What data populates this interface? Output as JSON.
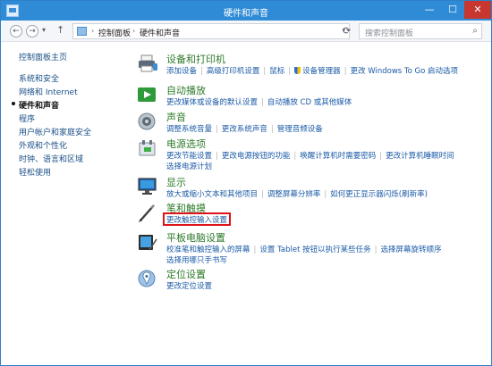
{
  "window": {
    "title": "硬件和声音",
    "min_glyph": "—",
    "max_glyph": "☐",
    "close_glyph": "✕"
  },
  "nav": {
    "back": "←",
    "forward": "→",
    "history": "▾",
    "up": "↑",
    "refresh": "⟳"
  },
  "breadcrumb": {
    "sep": "›",
    "items": [
      "控制面板",
      "硬件和声音"
    ],
    "dropdown": "▾"
  },
  "search": {
    "placeholder": "搜索控制面板",
    "icon": "⌕"
  },
  "sidebar": {
    "home": "控制面板主页",
    "items": [
      {
        "label": "系统和安全",
        "current": false
      },
      {
        "label": "网络和 Internet",
        "current": false
      },
      {
        "label": "硬件和声音",
        "current": true
      },
      {
        "label": "程序",
        "current": false
      },
      {
        "label": "用户帐户和家庭安全",
        "current": false
      },
      {
        "label": "外观和个性化",
        "current": false
      },
      {
        "label": "时钟、语言和区域",
        "current": false
      },
      {
        "label": "轻松使用",
        "current": false
      }
    ]
  },
  "categories": [
    {
      "title": "设备和打印机",
      "icon": "printer-icon",
      "links": [
        "添加设备",
        "高级打印机设置",
        "鼠标",
        "设备管理器",
        "更改 Windows To Go 启动选项"
      ],
      "link_shield": [
        false,
        false,
        false,
        true,
        false
      ]
    },
    {
      "title": "自动播放",
      "icon": "autoplay-icon",
      "links": [
        "更改媒体或设备的默认设置",
        "自动播放 CD 或其他媒体"
      ]
    },
    {
      "title": "声音",
      "icon": "speaker-icon",
      "links": [
        "调整系统音量",
        "更改系统声音",
        "管理音频设备"
      ]
    },
    {
      "title": "电源选项",
      "icon": "power-icon",
      "links": [
        "更改节能设置",
        "更改电源按钮的功能",
        "唤醒计算机时需要密码",
        "更改计算机睡眠时间",
        "选择电源计划"
      ],
      "link_line_break_after": 3
    },
    {
      "title": "显示",
      "icon": "display-icon",
      "links": [
        "放大或缩小文本和其他项目",
        "调整屏幕分辨率",
        "如何更正显示器闪烁(刷新率)"
      ]
    },
    {
      "title": "笔和触摸",
      "icon": "pen-icon",
      "links": [
        "更改触控输入设置"
      ],
      "highlight_link": 0
    },
    {
      "title": "平板电脑设置",
      "icon": "tablet-icon",
      "links": [
        "校准笔和触控输入的屏幕",
        "设置 Tablet 按钮以执行某些任务",
        "选择屏幕旋转顺序",
        "选择用哪只手书写"
      ],
      "link_line_break_after": 2
    },
    {
      "title": "定位设置",
      "icon": "location-icon",
      "links": [
        "更改定位设置"
      ]
    }
  ],
  "colors": {
    "titlebar": "#2f8bd6",
    "category_title": "#2d7a2a",
    "link": "#1a5aa6",
    "highlight_box": "#e0131a"
  }
}
